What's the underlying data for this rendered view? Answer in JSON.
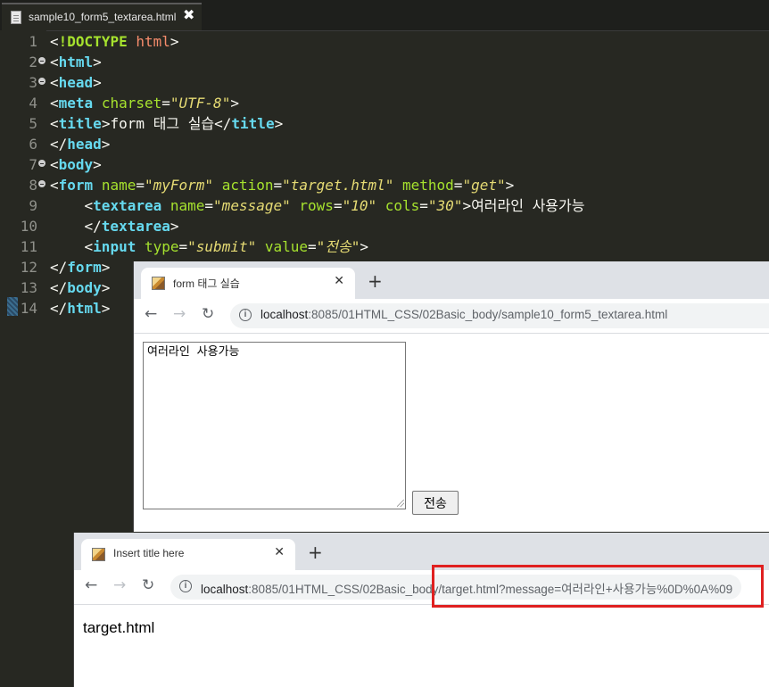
{
  "editor": {
    "tab_filename": "sample10_form5_textarea.html",
    "tab_close": "✖",
    "line_numbers": [
      "1",
      "2",
      "3",
      "4",
      "5",
      "6",
      "7",
      "8",
      "9",
      "10",
      "11",
      "12",
      "13",
      "14"
    ],
    "fold_lines": [
      "2",
      "3",
      "7",
      "8"
    ],
    "lines": [
      {
        "parts": [
          {
            "c": "pun",
            "t": "<"
          },
          {
            "c": "doc",
            "t": "!DOCTYPE"
          },
          {
            "c": "pun",
            "t": " "
          },
          {
            "c": "docattr",
            "t": "html"
          },
          {
            "c": "pun",
            "t": ">"
          }
        ]
      },
      {
        "parts": [
          {
            "c": "pun",
            "t": "<"
          },
          {
            "c": "tag",
            "t": "html"
          },
          {
            "c": "pun",
            "t": ">"
          }
        ]
      },
      {
        "parts": [
          {
            "c": "pun",
            "t": "<"
          },
          {
            "c": "tag",
            "t": "head"
          },
          {
            "c": "pun",
            "t": ">"
          }
        ]
      },
      {
        "parts": [
          {
            "c": "pun",
            "t": "<"
          },
          {
            "c": "tag",
            "t": "meta"
          },
          {
            "c": "pun",
            "t": " "
          },
          {
            "c": "att",
            "t": "charset"
          },
          {
            "c": "pun",
            "t": "="
          },
          {
            "c": "str",
            "t": "\"UTF-8\""
          },
          {
            "c": "pun",
            "t": ">"
          }
        ]
      },
      {
        "parts": [
          {
            "c": "pun",
            "t": "<"
          },
          {
            "c": "tag",
            "t": "title"
          },
          {
            "c": "pun",
            "t": ">"
          },
          {
            "c": "txt",
            "t": "form 태그 실습"
          },
          {
            "c": "pun",
            "t": "</"
          },
          {
            "c": "tag",
            "t": "title"
          },
          {
            "c": "pun",
            "t": ">"
          }
        ]
      },
      {
        "parts": [
          {
            "c": "pun",
            "t": "</"
          },
          {
            "c": "tag",
            "t": "head"
          },
          {
            "c": "pun",
            "t": ">"
          }
        ]
      },
      {
        "parts": [
          {
            "c": "pun",
            "t": "<"
          },
          {
            "c": "tag",
            "t": "body"
          },
          {
            "c": "pun",
            "t": ">"
          }
        ]
      },
      {
        "parts": [
          {
            "c": "pun",
            "t": "<"
          },
          {
            "c": "tag",
            "t": "form"
          },
          {
            "c": "pun",
            "t": " "
          },
          {
            "c": "att",
            "t": "name"
          },
          {
            "c": "pun",
            "t": "="
          },
          {
            "c": "str",
            "t": "\"myForm\""
          },
          {
            "c": "pun",
            "t": " "
          },
          {
            "c": "att",
            "t": "action"
          },
          {
            "c": "pun",
            "t": "="
          },
          {
            "c": "str",
            "t": "\"target.html\""
          },
          {
            "c": "pun",
            "t": " "
          },
          {
            "c": "att",
            "t": "method"
          },
          {
            "c": "pun",
            "t": "="
          },
          {
            "c": "str",
            "t": "\"get\""
          },
          {
            "c": "pun",
            "t": ">"
          }
        ]
      },
      {
        "parts": [
          {
            "c": "pun",
            "t": "    <"
          },
          {
            "c": "tag",
            "t": "textarea"
          },
          {
            "c": "pun",
            "t": " "
          },
          {
            "c": "att",
            "t": "name"
          },
          {
            "c": "pun",
            "t": "="
          },
          {
            "c": "str",
            "t": "\"message\""
          },
          {
            "c": "pun",
            "t": " "
          },
          {
            "c": "att",
            "t": "rows"
          },
          {
            "c": "pun",
            "t": "="
          },
          {
            "c": "str",
            "t": "\"10\""
          },
          {
            "c": "pun",
            "t": " "
          },
          {
            "c": "att",
            "t": "cols"
          },
          {
            "c": "pun",
            "t": "="
          },
          {
            "c": "str",
            "t": "\"30\""
          },
          {
            "c": "pun",
            "t": ">"
          },
          {
            "c": "txt",
            "t": "여러라인 사용가능"
          }
        ]
      },
      {
        "parts": [
          {
            "c": "pun",
            "t": "    </"
          },
          {
            "c": "tag",
            "t": "textarea"
          },
          {
            "c": "pun",
            "t": ">"
          }
        ]
      },
      {
        "parts": [
          {
            "c": "pun",
            "t": "    <"
          },
          {
            "c": "tag",
            "t": "input"
          },
          {
            "c": "pun",
            "t": " "
          },
          {
            "c": "att",
            "t": "type"
          },
          {
            "c": "pun",
            "t": "="
          },
          {
            "c": "str",
            "t": "\"submit\""
          },
          {
            "c": "pun",
            "t": " "
          },
          {
            "c": "att",
            "t": "value"
          },
          {
            "c": "pun",
            "t": "="
          },
          {
            "c": "str",
            "t": "\"전송\""
          },
          {
            "c": "pun",
            "t": ">"
          }
        ]
      },
      {
        "parts": [
          {
            "c": "pun",
            "t": "</"
          },
          {
            "c": "tag",
            "t": "form"
          },
          {
            "c": "pun",
            "t": ">"
          }
        ]
      },
      {
        "parts": [
          {
            "c": "pun",
            "t": "</"
          },
          {
            "c": "tag",
            "t": "body"
          },
          {
            "c": "pun",
            "t": ">"
          }
        ]
      },
      {
        "parts": [
          {
            "c": "pun",
            "t": "</"
          },
          {
            "c": "tag",
            "t": "html"
          },
          {
            "c": "pun",
            "t": ">"
          }
        ]
      }
    ]
  },
  "browser1": {
    "tab_title": "form 태그 실습",
    "tab_close": "✕",
    "new_tab": "+",
    "nav_back": "←",
    "nav_forward": "→",
    "nav_reload": "↻",
    "url_host": "localhost",
    "url_path": ":8085/01HTML_CSS/02Basic_body/sample10_form5_textarea.html",
    "textarea_value": "여러라인 사용가능",
    "submit_label": "전송"
  },
  "browser2": {
    "tab_title": "Insert title here",
    "tab_close": "✕",
    "new_tab": "+",
    "nav_back": "←",
    "nav_forward": "→",
    "nav_reload": "↻",
    "url_host": "localhost",
    "url_path": ":8085/01HTML_CSS/02Basic_body/target.html?message=여러라인+사용가능%0D%0A%09",
    "page_text": "target.html"
  },
  "colors": {
    "editor_bg": "#272822",
    "highlight_box": "#e02020"
  }
}
